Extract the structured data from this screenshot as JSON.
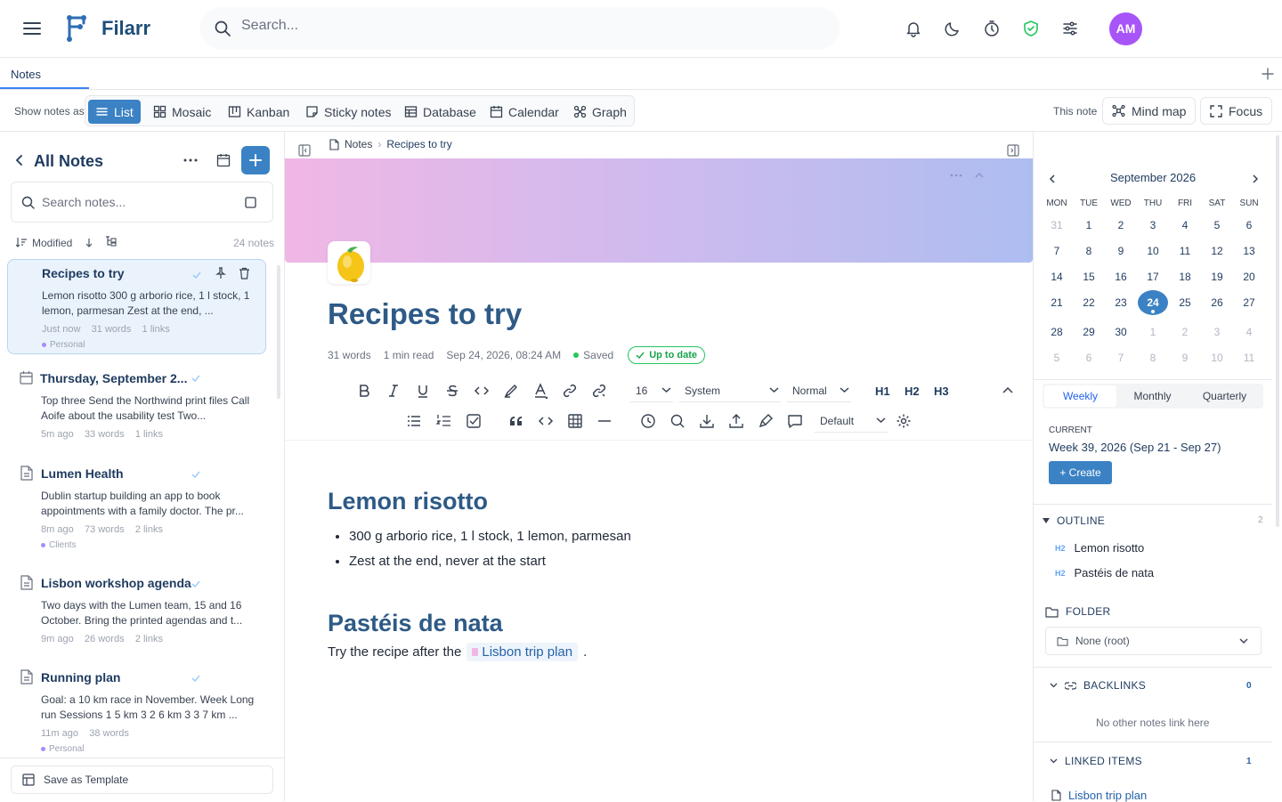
{
  "app": {
    "name": "Filarr",
    "avatar_initials": "AM"
  },
  "search": {
    "placeholder": "Search..."
  },
  "tabs": [
    {
      "label": "Notes"
    }
  ],
  "viewbar": {
    "show_label": "Show notes as",
    "views": [
      "List",
      "Mosaic",
      "Kanban",
      "Sticky notes",
      "Database",
      "Calendar",
      "Graph"
    ],
    "active_view": "List",
    "this_note_label": "This note",
    "mind_map_label": "Mind map",
    "focus_label": "Focus"
  },
  "sidebar": {
    "title": "All Notes",
    "search_placeholder": "Search notes...",
    "sort_label": "Modified",
    "count_label": "24 notes",
    "save_template_label": "Save as Template",
    "notes": [
      {
        "title": "Recipes to try",
        "excerpt": "Lemon risotto 300 g arborio rice, 1 l stock, 1 lemon, parmesan Zest at the end, ...",
        "time": "Just now",
        "words": "31 words",
        "links": "1 links",
        "tag": "Personal",
        "selected": true
      },
      {
        "title": "Thursday, September 2...",
        "excerpt": "Top three Send the Northwind print files Call Aoife about the usability test Two...",
        "time": "5m ago",
        "words": "33 words",
        "links": "1 links",
        "tag": ""
      },
      {
        "title": "Lumen Health",
        "excerpt": "Dublin startup building an app to book appointments with a family doctor. The pr...",
        "time": "8m ago",
        "words": "73 words",
        "links": "2 links",
        "tag": "Clients"
      },
      {
        "title": "Lisbon workshop agenda",
        "excerpt": "Two days with the Lumen team, 15 and 16 October. Bring the printed agendas and t...",
        "time": "9m ago",
        "words": "26 words",
        "links": "2 links",
        "tag": ""
      },
      {
        "title": "Running plan",
        "excerpt": "Goal: a 10 km race in November. Week Long run Sessions 1 5 km 3 2 6 km 3 3 7 km ...",
        "time": "11m ago",
        "words": "38 words",
        "links": "",
        "tag": "Personal"
      }
    ]
  },
  "editor": {
    "breadcrumb": [
      "Notes",
      "Recipes to try"
    ],
    "emoji": "lemon",
    "title": "Recipes to try",
    "meta": {
      "words": "31 words",
      "read": "1 min read",
      "date": "Sep 24, 2026, 08:24 AM",
      "saved": "Saved",
      "status": "Up to date"
    },
    "toolbar": {
      "font_size": "16",
      "font_family": "System",
      "block_style": "Normal",
      "style_preset": "Default",
      "h1": "H1",
      "h2": "H2",
      "h3": "H3"
    },
    "content": {
      "heading1": "Lemon risotto",
      "bullets": [
        "300 g arborio rice, 1 l stock, 1 lemon, parmesan",
        "Zest at the end, never at the start"
      ],
      "heading2": "Pastéis de nata",
      "paragraph_prefix": "Try the recipe after the",
      "link_text": "Lisbon trip plan",
      "paragraph_suffix": "."
    }
  },
  "calendar": {
    "month": "September 2026",
    "dow": [
      "MON",
      "TUE",
      "WED",
      "THU",
      "FRI",
      "SAT",
      "SUN"
    ],
    "weeks": [
      [
        "31",
        "1",
        "2",
        "3",
        "4",
        "5",
        "6"
      ],
      [
        "7",
        "8",
        "9",
        "10",
        "11",
        "12",
        "13"
      ],
      [
        "14",
        "15",
        "16",
        "17",
        "18",
        "19",
        "20"
      ],
      [
        "21",
        "22",
        "23",
        "24",
        "25",
        "26",
        "27"
      ],
      [
        "28",
        "29",
        "30",
        "1",
        "2",
        "3",
        "4"
      ],
      [
        "5",
        "6",
        "7",
        "8",
        "9",
        "10",
        "11"
      ]
    ],
    "today": "24",
    "periods": [
      "Weekly",
      "Monthly",
      "Quarterly"
    ],
    "active_period": "Weekly",
    "current_label": "CURRENT",
    "week_label": "Week 39, 2026 (Sep 21 - Sep 27)",
    "create_label": "+ Create"
  },
  "right_panel": {
    "outline": {
      "title": "OUTLINE",
      "count": "2",
      "items": [
        {
          "level": "H2",
          "text": "Lemon risotto"
        },
        {
          "level": "H2",
          "text": "Pastéis de nata"
        }
      ]
    },
    "folder": {
      "title": "FOLDER",
      "value": "None (root)"
    },
    "backlinks": {
      "title": "BACKLINKS",
      "count": "0",
      "empty": "No other notes link here"
    },
    "linked": {
      "title": "LINKED ITEMS",
      "count": "1",
      "items": [
        "Lisbon trip plan"
      ]
    }
  },
  "colors": {
    "accent": "#3b82c4",
    "title": "#2e5a86",
    "avatar": "#a855f7",
    "success": "#22c55e"
  }
}
